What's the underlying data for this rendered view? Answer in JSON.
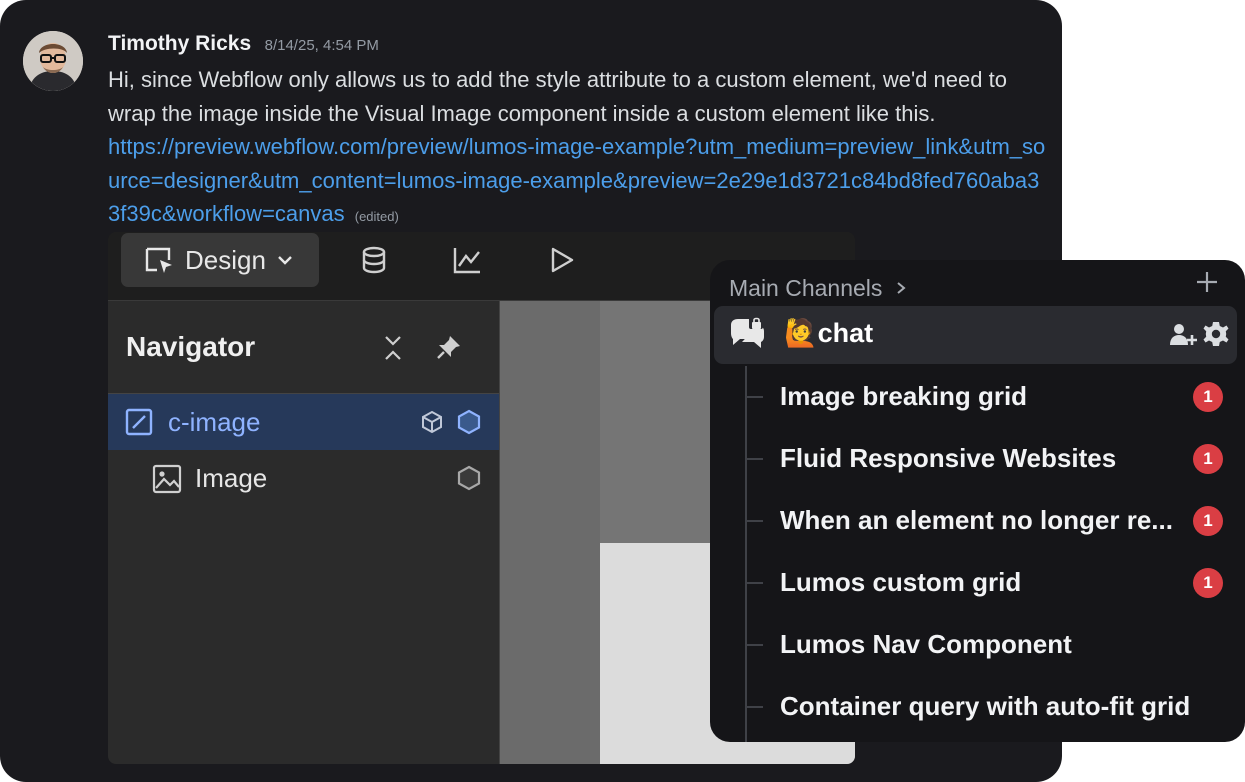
{
  "message": {
    "author": "Timothy Ricks",
    "timestamp": "8/14/25, 4:54 PM",
    "text": "Hi, since Webflow only allows us to add the style attribute to a custom element, we'd need to wrap the image inside the Visual Image component inside a custom element like this.",
    "link": "https://preview.webflow.com/preview/lumos-image-example?utm_medium=preview_link&utm_source=designer&utm_content=lumos-image-example&preview=2e29e1d3721c84bd8fed760aba33f39c&workflow=canvas",
    "edited_label": "(edited)"
  },
  "webflow": {
    "mode_label": "Design",
    "toolbar_icons": [
      "cursor-box-icon",
      "database-icon",
      "line-chart-icon",
      "play-icon"
    ],
    "navigator": {
      "title": "Navigator",
      "rows": [
        {
          "label": "c-image",
          "icon": "custom-element-icon",
          "selected": true
        },
        {
          "label": "Image",
          "icon": "image-icon",
          "selected": false
        }
      ]
    }
  },
  "channels": {
    "category": "Main Channels",
    "active_channel": "🙋chat",
    "threads": [
      {
        "name": "Image breaking grid",
        "unread": "1"
      },
      {
        "name": "Fluid Responsive Websites",
        "unread": "1"
      },
      {
        "name": "When an element no longer re...",
        "unread": "1"
      },
      {
        "name": "Lumos custom grid",
        "unread": "1"
      },
      {
        "name": "Lumos Nav Component",
        "unread": ""
      },
      {
        "name": "Container query with auto-fit grid",
        "unread": ""
      }
    ]
  },
  "colors": {
    "link": "#4c9eea",
    "badge": "#da3e44",
    "selected_row": "#26395a",
    "accent_blue": "#8fb3ff"
  }
}
